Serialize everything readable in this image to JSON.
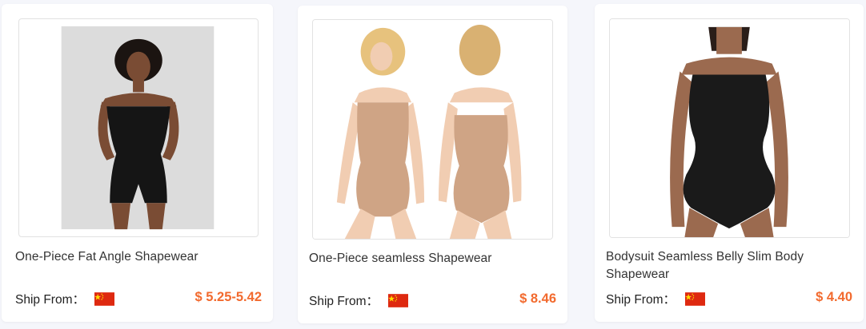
{
  "theme": {
    "price_color": "#f26a2e",
    "flag_red": "#de2910",
    "flag_yellow": "#ffde00"
  },
  "products": [
    {
      "title": "One-Piece Fat Angle Shapewear",
      "ship_label": "Ship From：",
      "flag": "china-flag-icon",
      "price": "$ 5.25-5.42",
      "image": "black strapless bodysuit shorts model"
    },
    {
      "title": "One-Piece seamless Shapewear",
      "ship_label": "Ship From：",
      "flag": "china-flag-icon",
      "price": "$ 8.46",
      "image": "nude seamless bodysuit front and back"
    },
    {
      "title": "Bodysuit Seamless Belly Slim Body Shapewear",
      "ship_label": "Ship From：",
      "flag": "china-flag-icon",
      "price": "$ 4.40",
      "image": "black seamless bodysuit model"
    }
  ]
}
